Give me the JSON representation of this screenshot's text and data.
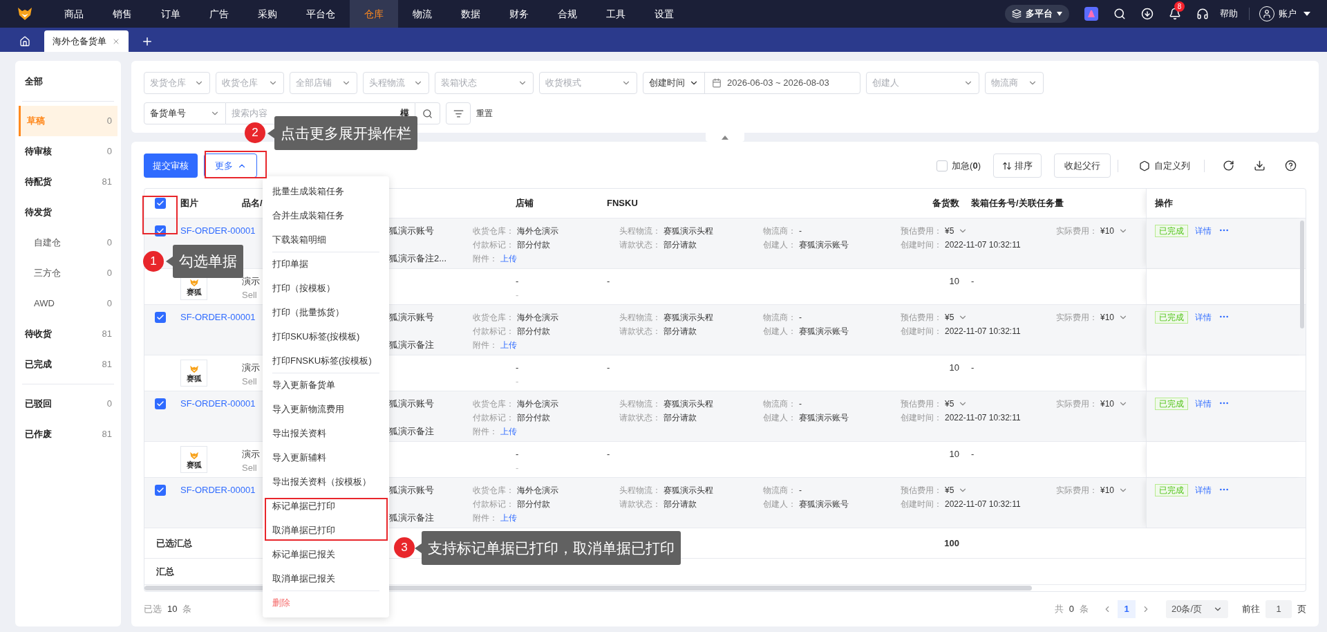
{
  "top_nav": {
    "menu": [
      {
        "label": "商品",
        "selected": false
      },
      {
        "label": "销售",
        "selected": false
      },
      {
        "label": "订单",
        "selected": false
      },
      {
        "label": "广告",
        "selected": false
      },
      {
        "label": "采购",
        "selected": false
      },
      {
        "label": "平台仓",
        "selected": false
      },
      {
        "label": "仓库",
        "selected": true
      },
      {
        "label": "物流",
        "selected": false
      },
      {
        "label": "数据",
        "selected": false
      },
      {
        "label": "财务",
        "selected": false
      },
      {
        "label": "合规",
        "selected": false
      },
      {
        "label": "工具",
        "selected": false
      },
      {
        "label": "设置",
        "selected": false
      }
    ],
    "platform": "多平台",
    "notification_count": "8",
    "help": "帮助",
    "account": "账户"
  },
  "tabs": [
    {
      "label": "海外仓备货单",
      "selected": true
    }
  ],
  "sidebar": {
    "groups": [
      [
        {
          "label": "全部",
          "selected": false
        }
      ],
      [
        {
          "label": "草稿",
          "count": "0",
          "selected": true
        },
        {
          "label": "待审核",
          "count": "0",
          "selected": false
        },
        {
          "label": "待配货",
          "count": "81",
          "selected": false
        },
        {
          "label": "待发货",
          "selected": false,
          "children": [
            {
              "label": "自建仓",
              "count": "0",
              "selected": false
            },
            {
              "label": "三方仓",
              "count": "0",
              "selected": false
            },
            {
              "label": "AWD",
              "count": "0",
              "selected": false
            }
          ]
        },
        {
          "label": "待收货",
          "count": "81",
          "selected": false
        },
        {
          "label": "已完成",
          "count": "81",
          "selected": false
        }
      ],
      [
        {
          "label": "已驳回",
          "count": "0",
          "selected": false
        },
        {
          "label": "已作废",
          "count": "81",
          "selected": false
        }
      ]
    ]
  },
  "filters": {
    "row1": [
      {
        "kind": "select",
        "placeholder": "发货仓库"
      },
      {
        "kind": "select",
        "placeholder": "收货仓库"
      },
      {
        "kind": "select",
        "placeholder": "全部店铺"
      },
      {
        "kind": "select",
        "placeholder": "头程物流"
      },
      {
        "kind": "select",
        "placeholder": "装箱状态"
      },
      {
        "kind": "select",
        "placeholder": "收货模式"
      },
      {
        "kind": "date_range",
        "label": "创建时间",
        "value": "2026-06-03 ~ 2026-08-03"
      },
      {
        "kind": "select",
        "placeholder": "创建人"
      },
      {
        "kind": "select",
        "placeholder": "物流商"
      }
    ],
    "search_type": "备货单号",
    "search": {
      "placeholder": "搜索内容",
      "mode": "模"
    },
    "reset": "重置"
  },
  "toolbar": {
    "submit": "提交审核",
    "more": {
      "label": "更多",
      "expanded": true
    },
    "urgent": {
      "label": "加急(**0**)",
      "checked": false
    },
    "sort": "排序",
    "collapse": "收起父行",
    "columns": "自定义列"
  },
  "table": {
    "header_checked": true,
    "columns": [
      "图片",
      "品名/",
      "店铺",
      "FNSKU",
      "备货数",
      "装箱任务号/关联任务量",
      "操作"
    ],
    "rows": [
      {
        "kind": "parent",
        "checked": true,
        "order": "SF-ORDER-00001",
        "account": "狐演示账号",
        "note": "狐演示备注2...",
        "info": [
          [
            {
              "name": "收货仓库：",
              "text": "海外仓演示",
              "kind": "text"
            },
            {
              "name": "付款标记：",
              "text": "部分付款",
              "kind": "text"
            },
            {
              "name": "附件：",
              "text": "上传",
              "kind": "link"
            }
          ],
          [
            {
              "name": "头程物流：",
              "text": "赛狐演示头程",
              "kind": "text"
            },
            {
              "name": "请款状态：",
              "text": "部分请款",
              "kind": "text"
            }
          ],
          [
            {
              "name": "物流商：",
              "text": "-",
              "kind": "text"
            },
            {
              "name": "创建人：",
              "text": "赛狐演示账号",
              "kind": "text"
            }
          ],
          [
            {
              "name": "预估费用：",
              "text": "¥5",
              "kind": "amount"
            },
            {
              "name": "创建时间：",
              "text": "2022-11-07 10:32:11",
              "kind": "text"
            }
          ],
          [
            {
              "name": "实际费用：",
              "text": "¥10",
              "kind": "amount"
            }
          ]
        ],
        "status": "已完成",
        "detail": "详情"
      },
      {
        "kind": "child",
        "thumb_label": "赛狐",
        "name": "演示",
        "sku": "Sell",
        "store": "-",
        "store_sub": "-",
        "fnsku": "-",
        "qty": "10",
        "task": "-"
      },
      {
        "kind": "parent",
        "checked": true,
        "order": "SF-ORDER-00001",
        "account": "狐演示账号",
        "note": "狐演示备注",
        "info": [
          [
            {
              "name": "收货仓库：",
              "text": "海外仓演示",
              "kind": "text"
            },
            {
              "name": "付款标记：",
              "text": "部分付款",
              "kind": "text"
            },
            {
              "name": "附件：",
              "text": "上传",
              "kind": "link"
            }
          ],
          [
            {
              "name": "头程物流：",
              "text": "赛狐演示头程",
              "kind": "text"
            },
            {
              "name": "请款状态：",
              "text": "部分请款",
              "kind": "text"
            }
          ],
          [
            {
              "name": "物流商：",
              "text": "-",
              "kind": "text"
            },
            {
              "name": "创建人：",
              "text": "赛狐演示账号",
              "kind": "text"
            }
          ],
          [
            {
              "name": "预估费用：",
              "text": "¥5",
              "kind": "amount"
            },
            {
              "name": "创建时间：",
              "text": "2022-11-07 10:32:11",
              "kind": "text"
            }
          ],
          [
            {
              "name": "实际费用：",
              "text": "¥10",
              "kind": "amount"
            }
          ]
        ],
        "status": "已完成",
        "detail": "详情"
      },
      {
        "kind": "child",
        "thumb_label": "赛狐",
        "name": "演示",
        "sku": "Sell",
        "store": "-",
        "store_sub": "-",
        "fnsku": "-",
        "qty": "10",
        "task": "-"
      },
      {
        "kind": "parent",
        "checked": true,
        "order": "SF-ORDER-00001",
        "account": "狐演示账号",
        "note": "狐演示备注",
        "info": [
          [
            {
              "name": "收货仓库：",
              "text": "海外仓演示",
              "kind": "text"
            },
            {
              "name": "付款标记：",
              "text": "部分付款",
              "kind": "text"
            },
            {
              "name": "附件：",
              "text": "上传",
              "kind": "link"
            }
          ],
          [
            {
              "name": "头程物流：",
              "text": "赛狐演示头程",
              "kind": "text"
            },
            {
              "name": "请款状态：",
              "text": "部分请款",
              "kind": "text"
            }
          ],
          [
            {
              "name": "物流商：",
              "text": "-",
              "kind": "text"
            },
            {
              "name": "创建人：",
              "text": "赛狐演示账号",
              "kind": "text"
            }
          ],
          [
            {
              "name": "预估费用：",
              "text": "¥5",
              "kind": "amount"
            },
            {
              "name": "创建时间：",
              "text": "2022-11-07 10:32:11",
              "kind": "text"
            }
          ],
          [
            {
              "name": "实际费用：",
              "text": "¥10",
              "kind": "amount"
            }
          ]
        ],
        "status": "已完成",
        "detail": "详情"
      },
      {
        "kind": "child",
        "thumb_label": "赛狐",
        "name": "演示",
        "sku": "Sell",
        "store": "-",
        "store_sub": "-",
        "fnsku": "-",
        "qty": "10",
        "task": "-"
      },
      {
        "kind": "parent",
        "checked": true,
        "order": "SF-ORDER-00001",
        "account": "狐演示账号",
        "note": "狐演示备注",
        "info": [
          [
            {
              "name": "收货仓库：",
              "text": "海外仓演示",
              "kind": "text"
            },
            {
              "name": "付款标记：",
              "text": "部分付款",
              "kind": "text"
            },
            {
              "name": "附件：",
              "text": "上传",
              "kind": "link"
            }
          ],
          [
            {
              "name": "头程物流：",
              "text": "赛狐演示头程",
              "kind": "text"
            },
            {
              "name": "请款状态：",
              "text": "部分请款",
              "kind": "text"
            }
          ],
          [
            {
              "name": "物流商：",
              "text": "-",
              "kind": "text"
            },
            {
              "name": "创建人：",
              "text": "赛狐演示账号",
              "kind": "text"
            }
          ],
          [
            {
              "name": "预估费用：",
              "text": "¥5",
              "kind": "amount"
            },
            {
              "name": "创建时间：",
              "text": "2022-11-07 10:32:11",
              "kind": "text"
            }
          ],
          [
            {
              "name": "实际费用：",
              "text": "¥10",
              "kind": "amount"
            }
          ]
        ],
        "status": "已完成",
        "detail": "详情"
      }
    ],
    "summary": [
      {
        "label": "已选汇总",
        "qty": "100"
      },
      {
        "label": "汇总"
      }
    ]
  },
  "footer": {
    "selected_prefix": "已选",
    "selected_count": "10",
    "selected_suffix": "条",
    "total_prefix": "共",
    "total": "0",
    "total_suffix": "条",
    "pages": [
      {
        "label": "1",
        "selected": true
      }
    ],
    "page_size": "20条/页",
    "goto": "前往",
    "goto_value": "1",
    "goto_suffix": "页"
  },
  "more_menu": {
    "groups": [
      [
        {
          "label": "批量生成装箱任务",
          "kind": "normal"
        },
        {
          "label": "合并生成装箱任务",
          "kind": "normal"
        },
        {
          "label": "下载装箱明细",
          "kind": "normal"
        }
      ],
      [
        {
          "label": "打印单据",
          "kind": "normal"
        },
        {
          "label": "打印（按模板）",
          "kind": "normal"
        },
        {
          "label": "打印（批量拣货）",
          "kind": "normal"
        },
        {
          "label": "打印SKU标签(按模板)",
          "kind": "normal"
        },
        {
          "label": "打印FNSKU标签(按模板)",
          "kind": "normal"
        }
      ],
      [
        {
          "label": "导入更新备货单",
          "kind": "normal"
        },
        {
          "label": "导入更新物流费用",
          "kind": "normal"
        },
        {
          "label": "导出报关资料",
          "kind": "normal"
        },
        {
          "label": "导入更新辅料",
          "kind": "normal"
        },
        {
          "label": "导出报关资料（按模板）",
          "kind": "normal"
        },
        {
          "label": "标记单据已打印",
          "kind": "normal"
        },
        {
          "label": "取消单据已打印",
          "kind": "normal"
        },
        {
          "label": "标记单据已报关",
          "kind": "normal"
        },
        {
          "label": "取消单据已报关",
          "kind": "normal"
        }
      ],
      [
        {
          "label": "删除",
          "kind": "danger"
        }
      ]
    ]
  },
  "annotations": [
    {
      "number": "1",
      "text": "勾选单据"
    },
    {
      "number": "2",
      "text": "点击更多展开操作栏"
    },
    {
      "number": "3",
      "text": "支持标记单据已打印，取消单据已打印"
    }
  ]
}
